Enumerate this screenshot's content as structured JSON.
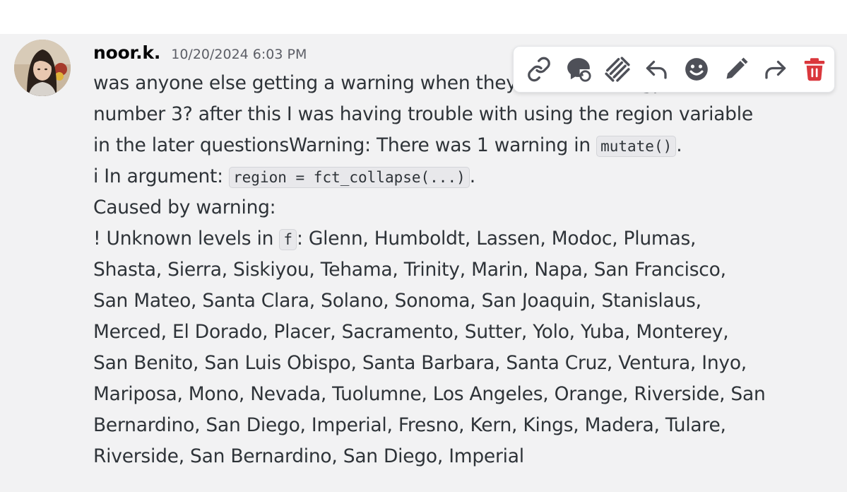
{
  "message": {
    "username": "noor.k.",
    "timestamp": "10/20/2024 6:03 PM",
    "lines": [
      [
        {
          "t": "was anyone else getting a warning when they ran the chat gpt code for"
        }
      ],
      [
        {
          "t": "number 3? after this I was having trouble with using the region variable"
        }
      ],
      [
        {
          "t": "in the later questionsWarning: There was 1 warning in "
        },
        {
          "c": "mutate()"
        },
        {
          "t": "."
        }
      ],
      [
        {
          "t": "i In argument: "
        },
        {
          "c": "region = fct_collapse(...)"
        },
        {
          "t": "."
        }
      ],
      [
        {
          "t": "Caused by warning:"
        }
      ],
      [
        {
          "t": "! Unknown levels in "
        },
        {
          "c": "f"
        },
        {
          "t": ": Glenn, Humboldt, Lassen, Modoc, Plumas,"
        }
      ],
      [
        {
          "t": "Shasta, Sierra, Siskiyou, Tehama, Trinity, Marin, Napa, San Francisco,"
        }
      ],
      [
        {
          "t": "San Mateo, Santa Clara, Solano, Sonoma, San Joaquin, Stanislaus,"
        }
      ],
      [
        {
          "t": "Merced, El Dorado, Placer, Sacramento, Sutter, Yolo, Yuba, Monterey,"
        }
      ],
      [
        {
          "t": "San Benito, San Luis Obispo, Santa Barbara, Santa Cruz, Ventura, Inyo,"
        }
      ],
      [
        {
          "t": "Mariposa, Mono, Nevada, Tuolumne, Los Angeles, Orange, Riverside, San"
        }
      ],
      [
        {
          "t": "Bernardino, San Diego, Imperial, Fresno, Kern, Kings, Madera, Tulare,"
        }
      ],
      [
        {
          "t": "Riverside, San Bernardino, San Diego, Imperial"
        }
      ]
    ]
  },
  "toolbar": {
    "icons": [
      "link-icon",
      "thread-icon",
      "bulk-copy-icon",
      "reply-icon",
      "emoji-icon",
      "edit-icon",
      "forward-icon",
      "delete-icon"
    ]
  },
  "colors": {
    "message_bg": "#f2f2f3",
    "icon": "#4e5058",
    "delete": "#da373c",
    "text": "#2e3338"
  }
}
